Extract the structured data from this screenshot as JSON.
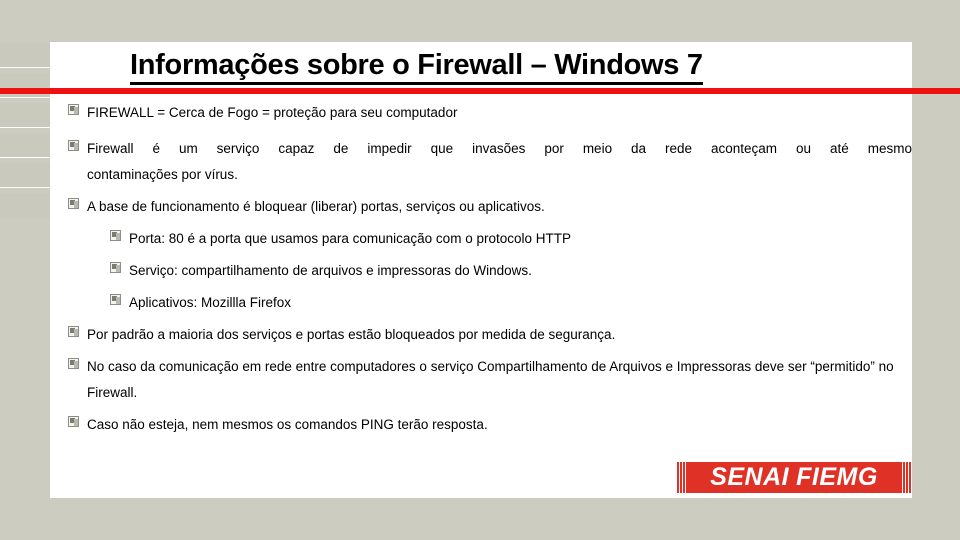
{
  "slide": {
    "title": "Informações sobre o Firewall – Windows 7",
    "background_color": "#ccccc0",
    "panel_color": "#ffffff",
    "accent_color": "#ef1111"
  },
  "bullets": [
    {
      "level": 1,
      "icon": "screen-bullet-icon",
      "text": "FIREWALL = Cerca de Fogo = proteção para seu computador"
    },
    {
      "level": 1,
      "icon": "screen-bullet-icon",
      "line1": "Firewall é um serviço capaz de impedir que invasões por meio da rede aconteçam ou até mesmo",
      "line2": "contaminações por vírus."
    },
    {
      "level": 1,
      "icon": "screen-bullet-icon",
      "text": "A base de funcionamento é bloquear (liberar) portas, serviços ou aplicativos."
    },
    {
      "level": 2,
      "icon": "screen-bullet-icon",
      "text": "Porta: 80 é a porta que usamos para comunicação com o protocolo HTTP"
    },
    {
      "level": 2,
      "icon": "screen-bullet-icon",
      "text": "Serviço: compartilhamento de arquivos e impressoras  do Windows."
    },
    {
      "level": 2,
      "icon": "screen-bullet-icon",
      "text": "Aplicativos: Mozillla Firefox"
    },
    {
      "level": 1,
      "icon": "screen-bullet-icon",
      "text": "Por padrão a maioria dos serviços e portas estão bloqueados por medida de segurança."
    },
    {
      "level": 1,
      "icon": "screen-bullet-icon",
      "line1": "No caso da comunicação em rede entre computadores o serviço Compartilhamento de Arquivos e Impressoras",
      "line2": "deve ser “permitido” no Firewall."
    },
    {
      "level": 1,
      "icon": "screen-bullet-icon",
      "text": "Caso não esteja, nem mesmos os comandos PING terão resposta."
    }
  ],
  "logo": {
    "part1": "SENAI",
    "part2": "FIEMG",
    "color": "#e03127"
  }
}
